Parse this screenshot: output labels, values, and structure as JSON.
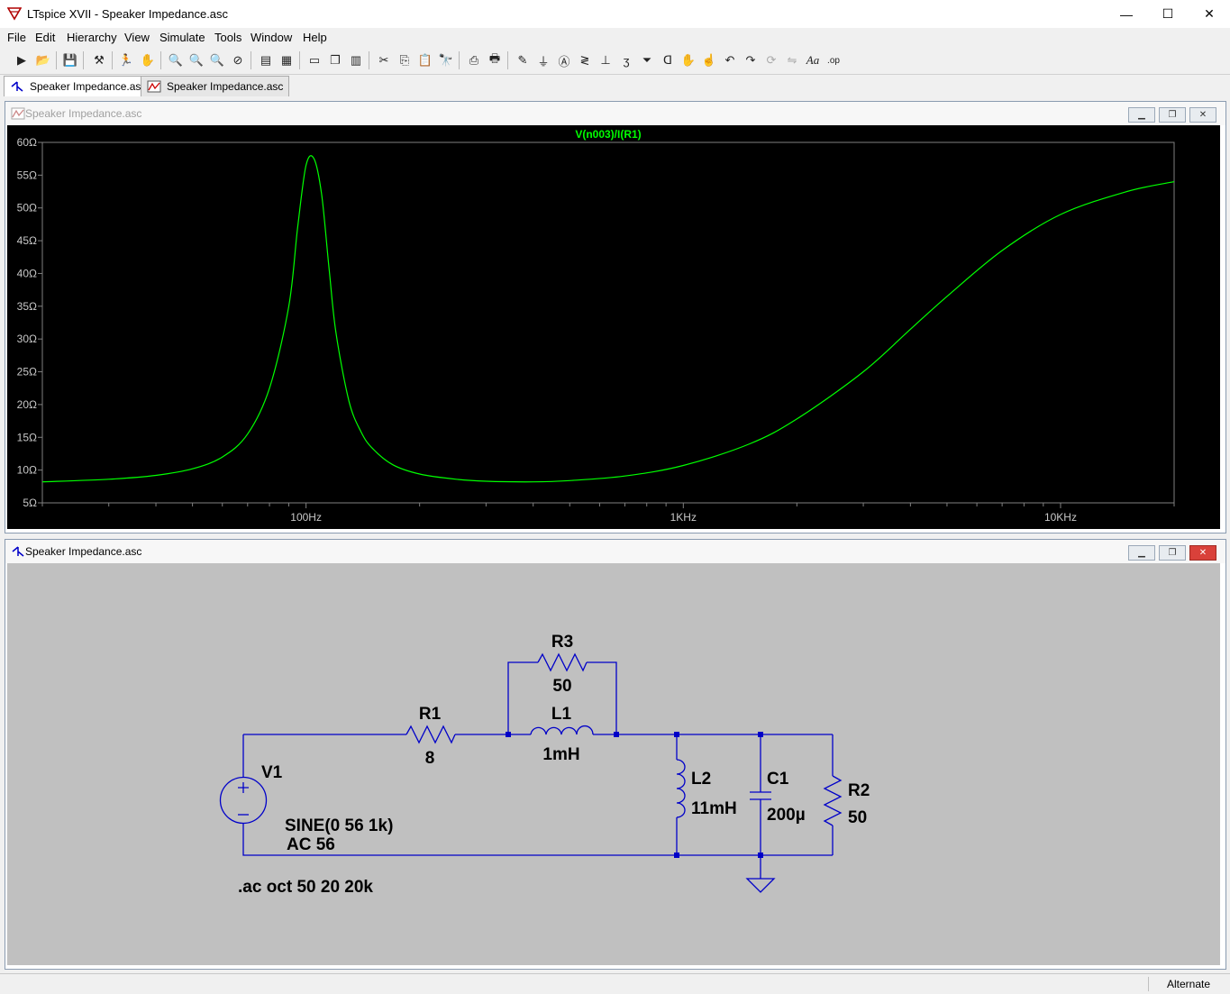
{
  "window": {
    "title": "LTspice XVII - Speaker Impedance.asc",
    "minimize": "—",
    "maximize": "☐",
    "close": "✕"
  },
  "menu": [
    "File",
    "Edit",
    "Hierarchy",
    "View",
    "Simulate",
    "Tools",
    "Window",
    "Help"
  ],
  "toolbar_icons": [
    "new-schematic-icon",
    "open-icon",
    "save-icon",
    "control-panel-icon",
    "run-icon",
    "halt-icon",
    "zoom-in-icon",
    "zoom-area-icon",
    "zoom-out-icon",
    "zoom-cancel-icon",
    "autorange-icon",
    "grid-icon",
    "tile-horizontal-icon",
    "cascade-icon",
    "tile-vertical-icon",
    "cut-icon",
    "copy-icon",
    "paste-icon",
    "find-icon",
    "print-preview-icon",
    "print-icon",
    "draw-wire-icon",
    "ground-icon",
    "label-net-icon",
    "resistor-icon",
    "capacitor-icon",
    "inductor-icon",
    "diode-icon",
    "component-icon",
    "move-icon",
    "drag-icon",
    "undo-icon",
    "redo-icon",
    "rotate-icon",
    "mirror-icon",
    "text-icon",
    "spice-directive-icon"
  ],
  "tabs": [
    {
      "label": "Speaker Impedance.asc",
      "icon": "schematic-icon"
    },
    {
      "label": "Speaker Impedance.asc",
      "icon": "waveform-icon"
    }
  ],
  "plot_window": {
    "title": "Speaker Impedance.asc",
    "trace_label": "V(n003)/I(R1)",
    "trace_color": "#00ff00",
    "background": "#000000",
    "grid_color": "#808080"
  },
  "schematic_window": {
    "title": "Speaker Impedance.asc",
    "background": "#c0c0c0",
    "wire_color": "#0000c8",
    "labels": {
      "r3_name": "R3",
      "r3_value": "50",
      "r1_name": "R1",
      "r1_value": "8",
      "l1_name": "L1",
      "l1_value": "1mH",
      "v1_name": "V1",
      "v1_sine": "SINE(0 56 1k)",
      "v1_ac": "AC 56",
      "l2_name": "L2",
      "l2_value": "11mH",
      "c1_name": "C1",
      "c1_value": "200µ",
      "r2_name": "R2",
      "r2_value": "50",
      "directive": ".ac oct 50 20 20k"
    }
  },
  "status": {
    "mode": "Alternate"
  },
  "chart_data": {
    "type": "line",
    "title": "V(n003)/I(R1)",
    "xscale": "log",
    "xlim": [
      20,
      20000
    ],
    "ylim": [
      5,
      60
    ],
    "x_ticks": [
      "100Hz",
      "1KHz",
      "10KHz"
    ],
    "x_tick_values": [
      100,
      1000,
      10000
    ],
    "y_ticks": [
      "60Ω",
      "55Ω",
      "50Ω",
      "45Ω",
      "40Ω",
      "35Ω",
      "30Ω",
      "25Ω",
      "20Ω",
      "15Ω",
      "10Ω",
      "5Ω"
    ],
    "y_tick_values": [
      60,
      55,
      50,
      45,
      40,
      35,
      30,
      25,
      20,
      15,
      10,
      5
    ],
    "grid": false,
    "series": [
      {
        "x": [
          20,
          30,
          40,
          50,
          60,
          70,
          80,
          90,
          95,
          100,
          105,
          110,
          115,
          120,
          130,
          140,
          150,
          170,
          200,
          250,
          300,
          400,
          500,
          700,
          1000,
          1500,
          2000,
          3000,
          4000,
          5000,
          7000,
          10000,
          15000,
          20000
        ],
        "y": [
          8.2,
          8.6,
          9.2,
          10.2,
          12.0,
          15.5,
          22.5,
          35.0,
          47.0,
          56.5,
          57.5,
          52.0,
          41.0,
          31.0,
          20.5,
          15.8,
          13.3,
          10.8,
          9.4,
          8.6,
          8.3,
          8.2,
          8.4,
          9.1,
          10.7,
          14.0,
          17.8,
          25.0,
          31.5,
          36.5,
          43.5,
          49.0,
          52.5,
          54.0
        ]
      }
    ]
  }
}
